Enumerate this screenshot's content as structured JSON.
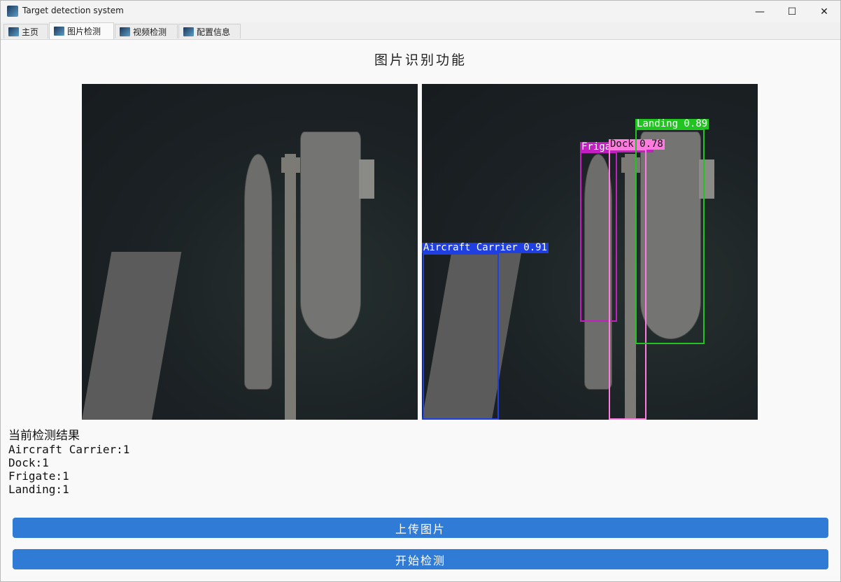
{
  "window": {
    "title": "Target detection system",
    "minimize": "—",
    "maximize": "☐",
    "close": "✕"
  },
  "tabs": [
    {
      "label": "主页"
    },
    {
      "label": "图片检测"
    },
    {
      "label": "视频检测"
    },
    {
      "label": "配置信息"
    }
  ],
  "page": {
    "title": "图片识别功能"
  },
  "detections": [
    {
      "label": "Aircraft Carrier 0.91",
      "color": "#1f3fe0"
    },
    {
      "label": "Frigate 0.78",
      "color": "#c21ec2"
    },
    {
      "label": "Dock 0.78",
      "color": "#ff7be0"
    },
    {
      "label": "Landing 0.89",
      "color": "#22c422"
    }
  ],
  "results": {
    "heading": "当前检测结果",
    "lines": [
      "Aircraft Carrier:1",
      "Dock:1",
      "Frigate:1",
      "Landing:1"
    ]
  },
  "buttons": {
    "upload": "上传图片",
    "detect": "开始检测",
    "color": "#2f7bd6"
  }
}
